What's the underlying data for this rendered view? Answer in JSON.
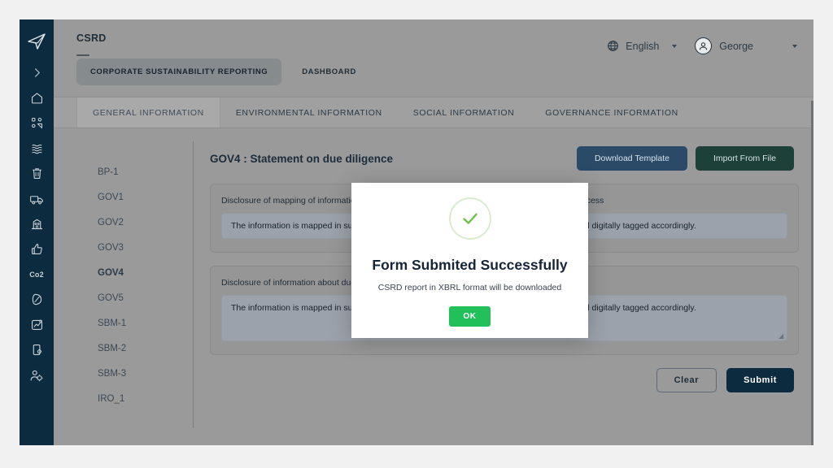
{
  "sidebar": {
    "logo_icon": "paper-plane-logo",
    "items": [
      {
        "icon": "chevron-right-icon",
        "name": "expand-sidebar"
      },
      {
        "icon": "home-icon",
        "name": "home"
      },
      {
        "icon": "materiality-icon",
        "name": "materiality"
      },
      {
        "icon": "water-icon",
        "name": "water"
      },
      {
        "icon": "waste-bin-icon",
        "name": "waste"
      },
      {
        "icon": "truck-icon",
        "name": "logistics"
      },
      {
        "icon": "building-icon",
        "name": "facilities"
      },
      {
        "icon": "thumbs-up-icon",
        "name": "social"
      },
      {
        "icon": "co2-text-icon",
        "name": "co2",
        "label": "Co2"
      },
      {
        "icon": "leaf-icon",
        "name": "environment"
      },
      {
        "icon": "chart-box-icon",
        "name": "analytics"
      },
      {
        "icon": "mobile-settings-icon",
        "name": "device-settings"
      },
      {
        "icon": "user-settings-icon",
        "name": "user-management"
      }
    ]
  },
  "header": {
    "brand": "CSRD",
    "language": {
      "icon": "globe-icon",
      "label": "English"
    },
    "user": {
      "icon": "avatar-icon",
      "label": "George"
    }
  },
  "nav": {
    "items": [
      {
        "label": "CORPORATE SUSTAINABILITY REPORTING",
        "active": true
      },
      {
        "label": "DASHBOARD",
        "active": false
      }
    ]
  },
  "tabs": [
    {
      "label": "GENERAL INFORMATION",
      "active": true
    },
    {
      "label": "ENVIRONMENTAL INFORMATION",
      "active": false
    },
    {
      "label": "SOCIAL INFORMATION",
      "active": false
    },
    {
      "label": "GOVERNANCE INFORMATION",
      "active": false
    }
  ],
  "sidelist": [
    {
      "label": "BP-1",
      "active": false
    },
    {
      "label": "GOV1",
      "active": false
    },
    {
      "label": "GOV2",
      "active": false
    },
    {
      "label": "GOV3",
      "active": false
    },
    {
      "label": "GOV4",
      "active": true
    },
    {
      "label": "GOV5",
      "active": false
    },
    {
      "label": "SBM-1",
      "active": false
    },
    {
      "label": "SBM-2",
      "active": false
    },
    {
      "label": "SBM-3",
      "active": false
    },
    {
      "label": "IRO_1",
      "active": false
    }
  ],
  "panel": {
    "title": "GOV4 : Statement on due diligence",
    "download_template_label": "Download Template",
    "import_from_file_label": "Import From File",
    "fields": [
      {
        "label": "Disclosure of mapping of information provided in sustainability statement about due diligence process",
        "value": "The information is mapped in sustainability statement with respective reporting parameters and digitally tagged accordingly."
      },
      {
        "label": "Disclosure of information about due diligence process (or cross-reference)",
        "value": "The information is mapped in sustainability statement with respective reporting parameters and digitally tagged accordingly."
      }
    ],
    "clear_label": "Clear",
    "submit_label": "Submit"
  },
  "modal": {
    "icon": "success-check-icon",
    "title": "Form Submited Successfully",
    "subtitle": "CSRD report in XBRL format will be downloaded",
    "ok_label": "OK"
  },
  "colors": {
    "sidebar_bg": "#0d2b3e",
    "download_btn": "#2b4a68",
    "import_btn": "#1d4038",
    "submit_btn": "#0d2b3e",
    "ok_btn": "#22c05a",
    "success_green": "#6fc04a"
  }
}
